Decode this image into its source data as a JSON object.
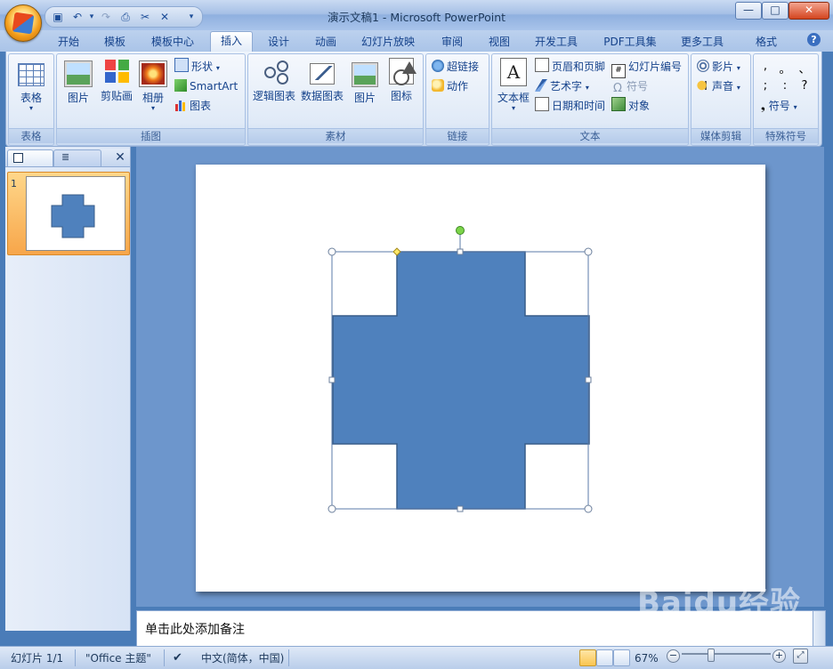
{
  "window": {
    "title": "演示文稿1 - Microsoft PowerPoint",
    "minimize": "—",
    "maximize": "□",
    "close": "✕"
  },
  "ribbon_tabs": [
    "开始",
    "模板",
    "模板中心",
    "插入",
    "设计",
    "动画",
    "幻灯片放映",
    "审阅",
    "视图",
    "开发工具",
    "PDF工具集",
    "更多工具",
    "格式"
  ],
  "active_tab": "插入",
  "groups": {
    "table": {
      "label": "表格",
      "button": "表格"
    },
    "illustrations": {
      "label": "插图",
      "picture": "图片",
      "clipart": "剪贴画",
      "album": "相册",
      "shape": "形状",
      "smartart": "SmartArt",
      "chart": "图表"
    },
    "assets": {
      "label": "素材",
      "logic_chart": "逻辑图表",
      "data_chart": "数据图表",
      "picture": "图片",
      "icon": "图标"
    },
    "links": {
      "label": "链接",
      "hyperlink": "超链接",
      "action": "动作"
    },
    "text": {
      "label": "文本",
      "textbox": "文本框",
      "header_footer": "页眉和页脚",
      "wordart": "艺术字",
      "datetime": "日期和时间",
      "slide_number": "幻灯片编号",
      "symbol": "符号",
      "object": "对象"
    },
    "media": {
      "label": "媒体剪辑",
      "movie": "影片",
      "sound": "声音"
    },
    "special": {
      "label": "特殊符号",
      "symbols": [
        ",",
        "。",
        "、",
        ";",
        ":",
        "?"
      ],
      "symbol_button": "符号"
    }
  },
  "panel": {
    "slide_number": "1",
    "close": "✕"
  },
  "notes": {
    "placeholder": "单击此处添加备注"
  },
  "status": {
    "slide": "幻灯片 1/1",
    "theme": "\"Office 主题\"",
    "language": "中文(简体，中国)",
    "zoom": "67%",
    "zoom_minus": "−",
    "zoom_plus": "+"
  },
  "watermark": {
    "text": "Baidu经验",
    "url": "jingyan.baidu.com"
  },
  "colors": {
    "shape_fill": "#4f81bd",
    "shape_stroke": "#385d8a",
    "accent": "#15428b"
  }
}
